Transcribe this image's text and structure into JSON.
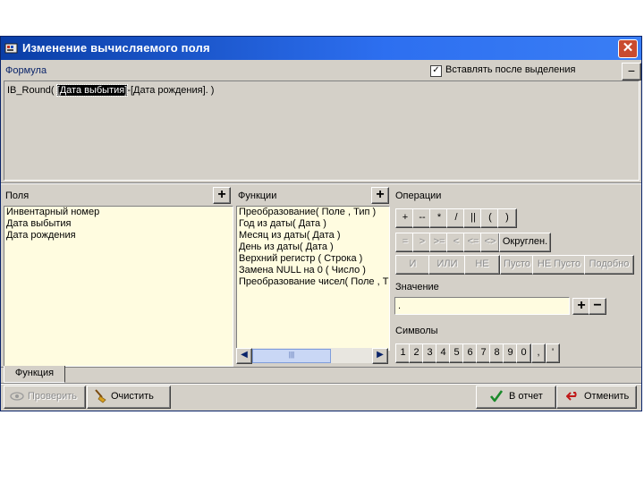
{
  "window": {
    "title": "Изменение вычисляемого поля",
    "close": "✕"
  },
  "formula": {
    "label": "Формула",
    "insert_after_selection": "Вставлять после выделения",
    "insert_checked": true,
    "collapse_symbol": "−",
    "text_prefix": "IB_Round( ",
    "text_selected": "[Дата выбытия]",
    "text_suffix": "-[Дата рождения]. )"
  },
  "fields": {
    "header": "Поля",
    "add_symbol": "+",
    "items": [
      "Инвентарный номер",
      "Дата выбытия",
      "Дата рождения"
    ]
  },
  "functions": {
    "header": "Функции",
    "add_symbol": "+",
    "items": [
      "Преобразование( Поле , Тип )",
      "Год из даты( Дата )",
      "Месяц из даты( Дата )",
      "День из даты( Дата )",
      "Верхний регистр ( Строка )",
      "Замена NULL на 0 ( Число )",
      "Преобразование чисел( Поле , Т"
    ],
    "scroll_thumb": "|||"
  },
  "operations": {
    "header": "Операции",
    "row1": [
      "+",
      "--",
      "*",
      "/",
      "||",
      "(",
      ")"
    ],
    "row2": [
      "=",
      ">",
      ">=",
      "<",
      "<=",
      "<>"
    ],
    "round": "Округлен.",
    "row3": [
      "И",
      "ИЛИ",
      "НЕ",
      "Пусто",
      "НЕ Пусто",
      "Подобно"
    ]
  },
  "value": {
    "header": "Значение",
    "current": ".",
    "plus": "+",
    "minus": "−"
  },
  "symbols": {
    "header": "Символы",
    "keys": [
      "1",
      "2",
      "3",
      "4",
      "5",
      "6",
      "7",
      "8",
      "9",
      "0",
      ",",
      "'"
    ]
  },
  "tabs": {
    "function": "Функция"
  },
  "buttons": {
    "check": "Проверить",
    "clear": "Очистить",
    "to_report": "В отчет",
    "cancel": "Отменить"
  }
}
